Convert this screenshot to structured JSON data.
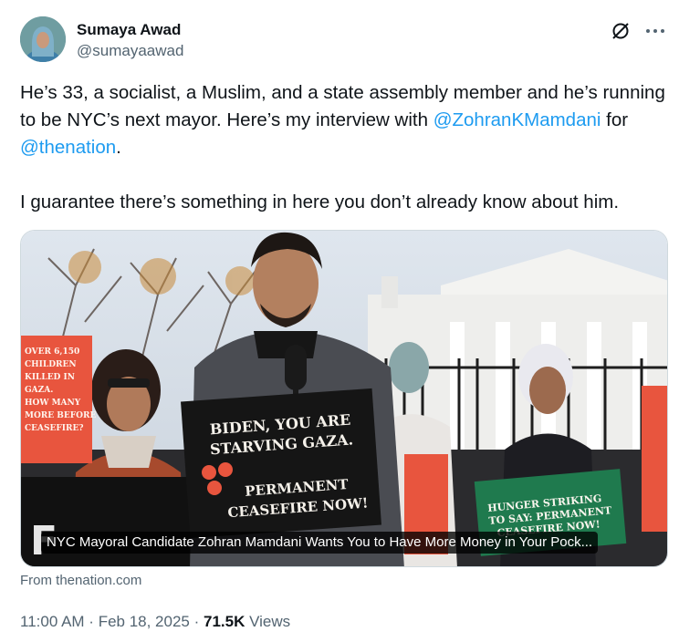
{
  "author": {
    "display_name": "Sumaya Awad",
    "handle": "@sumayaawad"
  },
  "icons": {
    "grok": "grok-icon",
    "more": "more-options-icon"
  },
  "tweet": {
    "line1": "He’s 33, a socialist, a Muslim, and a state assembly member and he’s running to be NYC’s next mayor. Here’s my interview with ",
    "mention1": "@ZohranKMamdani",
    "text_for": " for ",
    "mention2": "@thenation",
    "text_period": ".",
    "line2": "I guarantee there’s something in here you don’t already know about him."
  },
  "card": {
    "caption": "NYC Mayoral Candidate Zohran Mamdani Wants You to Have More Money in Your Pock...",
    "source": "From thenation.com",
    "signs": {
      "center_line1": "BIDEN, YOU ARE",
      "center_line2": "STARVING GAZA.",
      "center_line3": "PERMANENT",
      "center_line4": "CEASEFIRE NOW!",
      "left_line1": "OVER 6,150",
      "left_line2": "CHILDREN",
      "left_line3": "KILLED IN",
      "left_line4": "GAZA.",
      "left_line5": "HOW MANY",
      "left_line6": "MORE BEFORE",
      "left_line7": "CEASEFIRE?",
      "right_line1": "HUNGER STRIKING",
      "right_line2": "TO SAY: PERMANENT",
      "right_line3": "CEASEFIRE NOW!"
    }
  },
  "meta": {
    "time": "11:00 AM",
    "sep1": " · ",
    "date": "Feb 18, 2025",
    "sep2": " · ",
    "views_count": "71.5K",
    "views_label": " Views"
  },
  "colors": {
    "link": "#1d9bf0",
    "secondary_text": "#536471",
    "primary_text": "#0f1419"
  }
}
